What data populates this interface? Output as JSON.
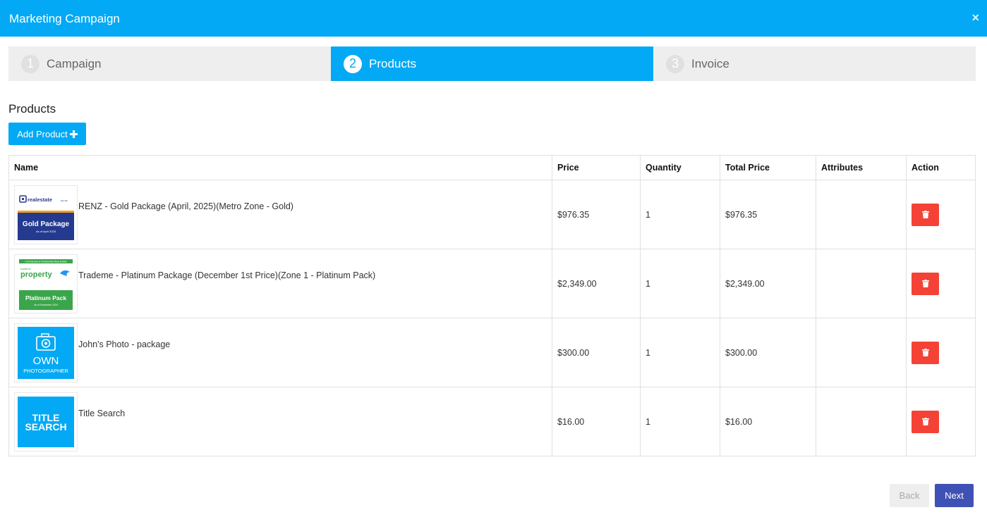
{
  "header": {
    "title": "Marketing Campaign",
    "close_label": "×"
  },
  "steps": [
    {
      "num": "1",
      "label": "Campaign"
    },
    {
      "num": "2",
      "label": "Products"
    },
    {
      "num": "3",
      "label": "Invoice"
    }
  ],
  "section": {
    "title": "Products",
    "add_label": "Add Product"
  },
  "table": {
    "headers": [
      "Name",
      "Price",
      "Quantity",
      "Total Price",
      "Attributes",
      "Action"
    ],
    "rows": [
      {
        "name": "RENZ - Gold Package (April, 2025)(Metro Zone - Gold)",
        "price": "$976.35",
        "quantity": "1",
        "total": "$976.35",
        "attributes": "",
        "thumb": {
          "brand": "realestate",
          "brand_suffix": ".co.nz",
          "package": "Gold Package",
          "sub": "As of April 2025"
        }
      },
      {
        "name": "Trademe - Platinum Package (December 1st Price)(Zone 1 - Platinum Pack)",
        "price": "$2,349.00",
        "quantity": "1",
        "total": "$2,349.00",
        "attributes": "",
        "thumb": {
          "top": "Commercial & Residential Real Estate",
          "brand_small": "trademe",
          "brand": "property",
          "package": "Platinum Pack",
          "sub": "As of December 2024"
        }
      },
      {
        "name": "John's Photo - package",
        "price": "$300.00",
        "quantity": "1",
        "total": "$300.00",
        "attributes": "",
        "thumb": {
          "line1": "OWN",
          "line2": "PHOTOGRAPHER"
        }
      },
      {
        "name": "Title Search",
        "price": "$16.00",
        "quantity": "1",
        "total": "$16.00",
        "attributes": "",
        "thumb": {
          "line1": "TITLE",
          "line2": "SEARCH"
        }
      }
    ]
  },
  "footer": {
    "back_label": "Back",
    "next_label": "Next"
  },
  "colors": {
    "primary": "#03a9f4",
    "danger": "#f44336",
    "next": "#3f51b5"
  }
}
